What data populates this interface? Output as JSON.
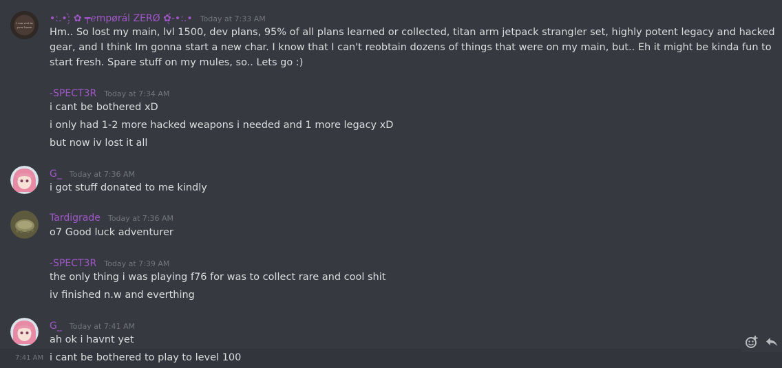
{
  "messages": [
    {
      "username": "•:.•:̗̀ ✿ ┯ℯmpørál ZERØ ✿̖́-•:.•",
      "timestamp": "Today at 7:33 AM",
      "avatar_icon": "dark-logo-avatar",
      "lines": [
        "Hm.. So lost my main, lvl 1500, dev plans, 95% of all plans learned or collected, titan arm jetpack strangler set, highly potent legacy and hacked gear, and I think Im gonna start a new char. I know that I can't reobtain dozens of things that were on my main, but.. Eh it might be kinda fun to start fresh. Spare stuff on my mules, so.. Lets go :)"
      ]
    },
    {
      "username": "-SPECT3R",
      "timestamp": "Today at 7:34 AM",
      "lines": [
        "i cant be bothered xD",
        "i only had 1-2 more hacked weapons i needed and 1 more legacy xD",
        "but now iv lost it all"
      ]
    },
    {
      "username": "G_",
      "timestamp": "Today at 7:36 AM",
      "avatar_icon": "anime-girl-avatar",
      "lines": [
        "i got stuff donated to me kindly"
      ]
    },
    {
      "username": "Tardigrade",
      "timestamp": "Today at 7:36 AM",
      "avatar_icon": "tardigrade-avatar",
      "lines": [
        "o7 Good luck adventurer"
      ]
    },
    {
      "username": "-SPECT3R",
      "timestamp": "Today at 7:39 AM",
      "lines": [
        "the only thing i was playing f76 for was to collect rare and cool shit",
        "iv finished n.w and everthing"
      ]
    },
    {
      "username": "G_",
      "timestamp": "Today at 7:41 AM",
      "avatar_icon": "anime-girl-avatar",
      "lines": [
        "ah ok i havnt yet"
      ]
    }
  ],
  "hovered_message": {
    "time": "7:41 AM",
    "text": "i cant be bothered to play to level 100"
  },
  "actions": {
    "add_reaction_icon": "add-reaction-icon",
    "reply_icon": "reply-icon"
  },
  "colors": {
    "background": "#36393f",
    "username": "#a157c9",
    "text": "#dcddde",
    "timestamp": "#72767d"
  }
}
